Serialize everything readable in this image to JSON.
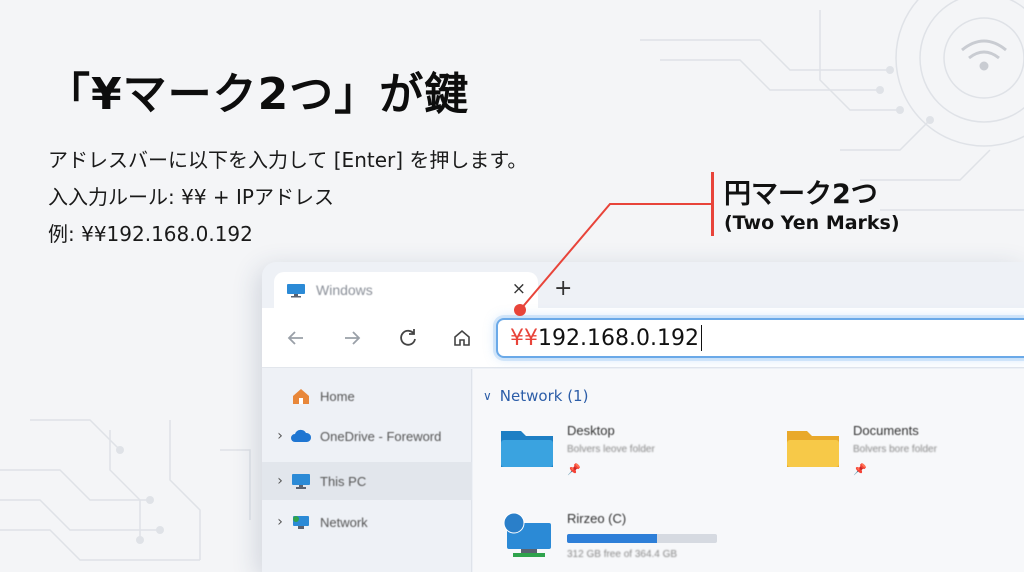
{
  "heading": {
    "title": "「¥マーク2つ」が鍵",
    "lines": [
      "アドレスバーに以下を入力して [Enter] を押します。",
      "入入力ルール: ¥¥ + IPアドレス",
      "例: ¥¥192.168.0.192"
    ]
  },
  "callout": {
    "title": "円マーク2つ",
    "subtitle": "(Two Yen Marks)",
    "color": "#e8443a"
  },
  "browser": {
    "tab": {
      "title": "Windows",
      "icon": "monitor-icon",
      "close": "×"
    },
    "new_tab": "+",
    "nav": {
      "back": "arrow-left-icon",
      "forward": "arrow-right-icon",
      "refresh": "refresh-icon",
      "home": "home-icon"
    },
    "address": {
      "yen": "¥¥",
      "ip": "192.168.0.192",
      "highlight_color": "#6aa9e8"
    }
  },
  "sidebar": {
    "items": [
      {
        "label": "Home",
        "icon": "home-icon",
        "chevron": ""
      },
      {
        "label": "OneDrive - Foreword",
        "icon": "cloud-icon",
        "chevron": "›"
      },
      {
        "label": "This PC",
        "icon": "pc-icon",
        "chevron": "›",
        "selected": true
      },
      {
        "label": "Network",
        "icon": "network-icon",
        "chevron": "›"
      }
    ]
  },
  "content": {
    "section": {
      "chevron": "∨",
      "label": "Network (1)"
    },
    "items": [
      {
        "name": "Desktop",
        "sub": "Bolvers leove folder",
        "icon": "blue-folder-icon"
      },
      {
        "name": "Documents",
        "sub": "Bolvers bore folder",
        "icon": "yellow-folder-icon"
      },
      {
        "name": "Rirzeo (C)",
        "sub": "312 GB free of 364.4 GB",
        "icon": "drive-icon",
        "used_fraction": 0.6
      }
    ],
    "pin": "📌"
  }
}
